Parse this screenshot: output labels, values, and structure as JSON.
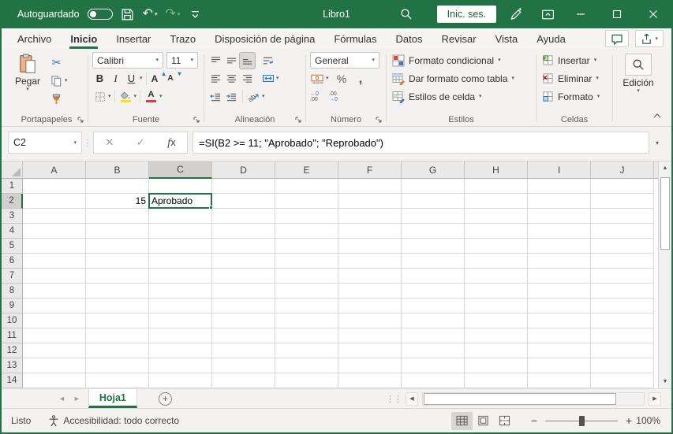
{
  "window": {
    "autosave_label": "Autoguardado",
    "title": "Libro1",
    "signin_label": "Inic. ses."
  },
  "menu_tabs": {
    "items": [
      "Archivo",
      "Inicio",
      "Insertar",
      "Trazo",
      "Disposición de página",
      "Fórmulas",
      "Datos",
      "Revisar",
      "Vista",
      "Ayuda"
    ],
    "active": "Inicio"
  },
  "ribbon": {
    "clipboard": {
      "label": "Portapapeles",
      "paste": "Pegar"
    },
    "font": {
      "label": "Fuente",
      "family": "Calibri",
      "size": "11"
    },
    "alignment": {
      "label": "Alineación"
    },
    "number": {
      "label": "Número",
      "format": "General"
    },
    "styles": {
      "label": "Estilos",
      "items": [
        "Formato condicional",
        "Dar formato como tabla",
        "Estilos de celda"
      ]
    },
    "cells": {
      "label": "Celdas",
      "items": [
        "Insertar",
        "Eliminar",
        "Formato"
      ]
    },
    "editing": {
      "label": "Edición"
    }
  },
  "formula_bar": {
    "name_box": "C2",
    "formula": "=SI(B2 >= 11; \"Aprobado\"; \"Reprobado\")"
  },
  "grid": {
    "columns": [
      "A",
      "B",
      "C",
      "D",
      "E",
      "F",
      "G",
      "H",
      "I",
      "J"
    ],
    "rows": [
      "1",
      "2",
      "3",
      "4",
      "5",
      "6",
      "7",
      "8",
      "9",
      "10",
      "11",
      "12",
      "13",
      "14"
    ],
    "selection": {
      "cell": "C2",
      "column": "C",
      "row": "2"
    },
    "cells": {
      "B2": "15",
      "C2": "Aprobado"
    }
  },
  "sheets": {
    "tabs": [
      "Hoja1"
    ],
    "active": "Hoja1"
  },
  "status_bar": {
    "mode": "Listo",
    "accessibility": "Accesibilidad: todo correcto",
    "zoom_level": "100%"
  },
  "colors": {
    "brand_green": "#217346",
    "fill_yellow": "#FFE000",
    "font_red": "#E03C31"
  },
  "icons": {
    "undo": "↶",
    "redo": "↷",
    "chevron_down": "▾",
    "chevron_up": "▴",
    "scissors": "✂",
    "bold": "B",
    "italic": "I",
    "underline": "U",
    "grow_font": "A",
    "shrink_font": "A",
    "font_color": "A",
    "percent": "%",
    "comma": ",",
    "inc_dec_top": "←0",
    "inc_dec_bot": ".00",
    "dec_dec_top": ".00",
    "dec_dec_bot": "→0",
    "orientation_ab": "ab",
    "cancel": "✕",
    "confirm": "✓",
    "fx_f": "f",
    "fx_x": "x",
    "dots_v": "⋮",
    "dots_v2": "⋮⋮",
    "arrow_up": "▲",
    "arrow_down": "▼",
    "arrow_left": "◀",
    "arrow_right": "▶",
    "nav_left": "◄",
    "nav_right": "►",
    "plus": "+",
    "minus": "−"
  }
}
